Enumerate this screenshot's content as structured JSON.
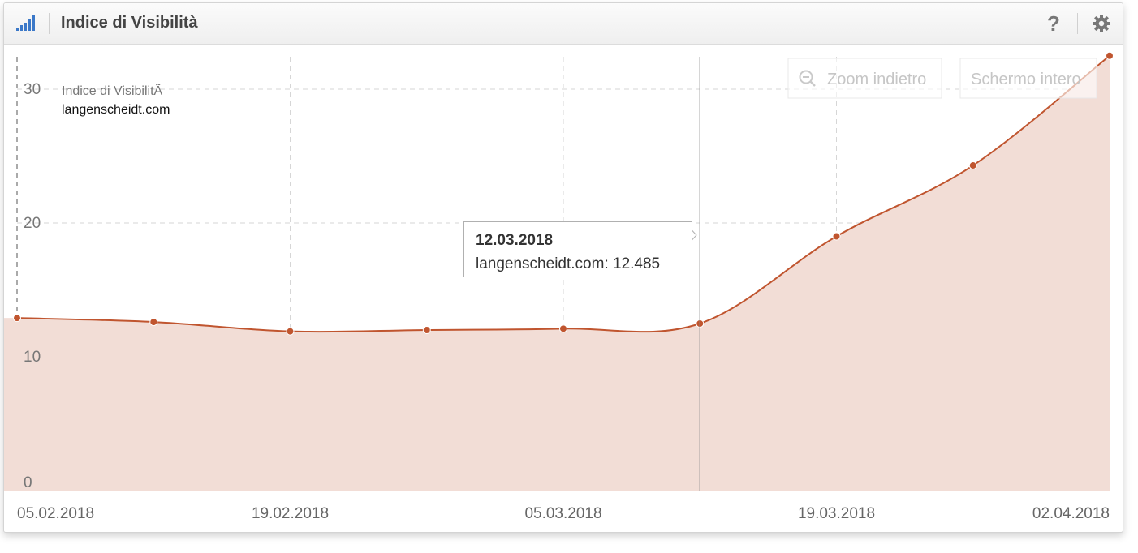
{
  "widget": {
    "title": "Indice di Visibilità",
    "help_label": "?"
  },
  "colors": {
    "line": "#c0552f",
    "area": "#f2ddd6",
    "accent_icon": "#3b78c8",
    "grid": "#d6d6d6"
  },
  "chart_data": {
    "type": "area",
    "x": [
      "05.02.2018",
      "12.02.2018",
      "19.02.2018",
      "26.02.2018",
      "05.03.2018",
      "12.03.2018",
      "19.03.2018",
      "26.03.2018",
      "02.04.2018"
    ],
    "x_tick_labels": [
      "05.02.2018",
      "19.02.2018",
      "05.03.2018",
      "19.03.2018",
      "02.04.2018"
    ],
    "y_ticks": [
      "0",
      "10",
      "20",
      "30"
    ],
    "ylim": [
      0,
      32.7
    ],
    "series": [
      {
        "name": "langenscheidt.com",
        "values": [
          12.9,
          12.6,
          11.9,
          12.0,
          12.1,
          12.485,
          19.0,
          24.3,
          32.5
        ]
      }
    ],
    "legend": {
      "title": "Indice di VisibilitÃ",
      "entry": "langenscheidt.com",
      "position": "top-left"
    },
    "grid": true,
    "buttons": {
      "zoom_out": "Zoom indietro",
      "fullscreen": "Schermo intero"
    },
    "tooltip": {
      "date": "12.03.2018",
      "series": "langenscheidt.com",
      "value": "12.485",
      "index": 5
    }
  }
}
